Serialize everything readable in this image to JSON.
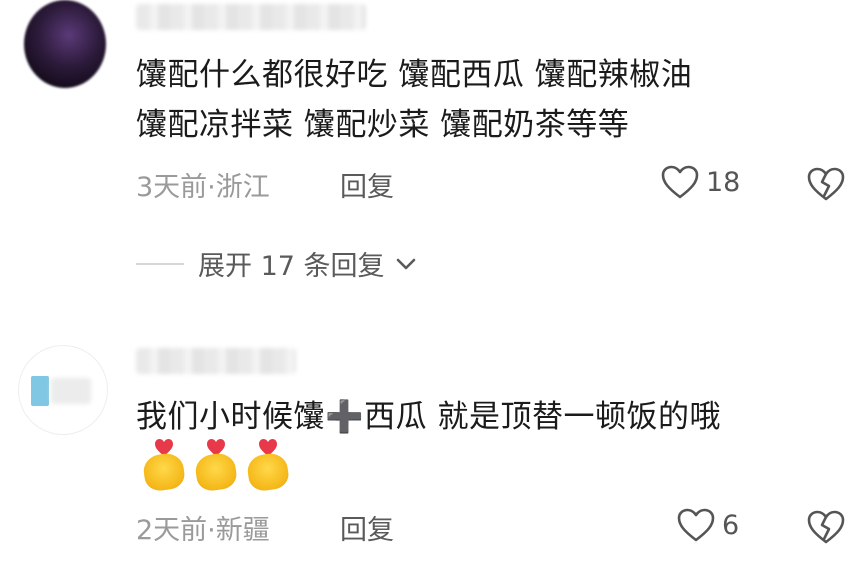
{
  "comments": [
    {
      "lines": [
        "馕配什么都很好吃 馕配西瓜 馕配辣椒油",
        "馕配凉拌菜  馕配炒菜 馕配奶茶等等"
      ],
      "meta": "3天前·浙江",
      "reply_label": "回复",
      "like_count": "18",
      "avatar_icon": "user-avatar-icon",
      "like_icon": "heart-outline-icon",
      "dislike_icon": "broken-heart-icon"
    },
    {
      "lines": [
        "我们小时候馕➕西瓜 就是顶替一顿饭的哦"
      ],
      "emoji": [
        "heart-hands-emoji",
        "heart-hands-emoji",
        "heart-hands-emoji"
      ],
      "meta": "2天前·新疆",
      "reply_label": "回复",
      "like_count": "6",
      "avatar_icon": "user-avatar-icon",
      "like_icon": "heart-outline-icon",
      "dislike_icon": "broken-heart-icon"
    }
  ],
  "expand_replies": {
    "label": "展开 17 条回复",
    "icon": "chevron-down-icon"
  },
  "colors": {
    "text": "#1b1b1b",
    "meta": "#9a9a9a",
    "action": "#5a5a5a",
    "emoji_yellow": "#f5b819",
    "emoji_heart": "#e8394a"
  }
}
